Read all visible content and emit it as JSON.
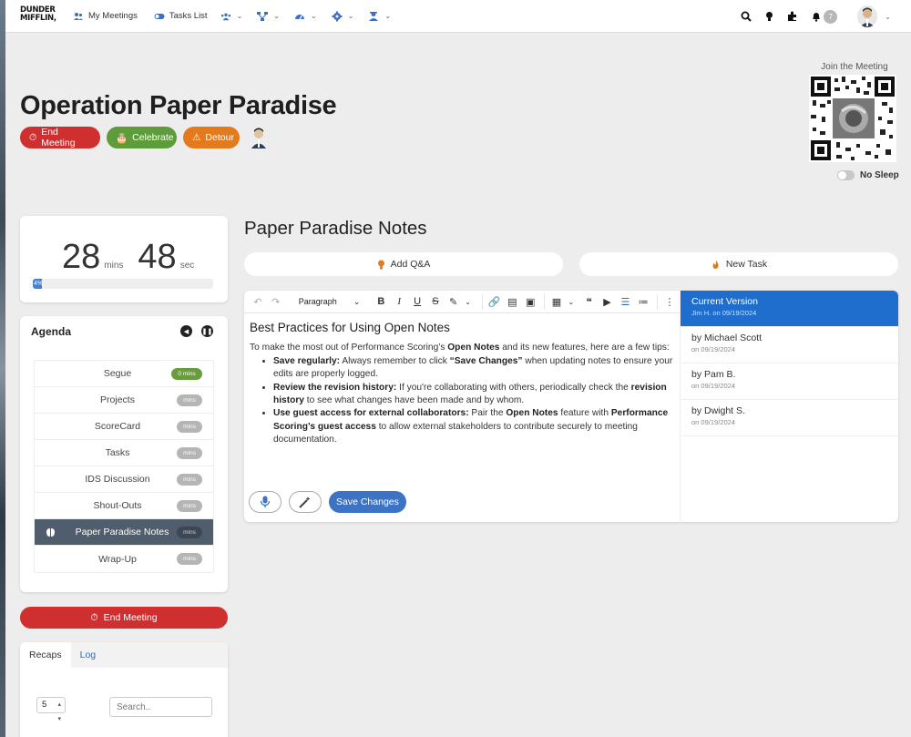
{
  "nav": {
    "logo_line1": "DUNDER",
    "logo_line2": "MIFFLIN,",
    "my_meetings": "My Meetings",
    "tasks_list": "Tasks List",
    "notification_count": "7",
    "icons": [
      "users-icon",
      "org-chart-icon",
      "dashboard-icon",
      "gear-icon",
      "admin-icon",
      "search-icon",
      "lightbulb-icon",
      "puzzle-icon",
      "bell-icon"
    ]
  },
  "header": {
    "title": "Operation Paper Paradise",
    "end_meeting": "End Meeting",
    "celebrate": "Celebrate",
    "detour": "Detour",
    "join_label": "Join the Meeting",
    "no_sleep": "No Sleep"
  },
  "timer": {
    "minutes": "28",
    "minutes_unit": "mins",
    "seconds": "48",
    "seconds_unit": "sec",
    "progress_label": "4%",
    "progress_value": 0.04
  },
  "agenda": {
    "title": "Agenda",
    "items": [
      {
        "label": "Segue",
        "mins": "0 mins"
      },
      {
        "label": "Projects",
        "mins": "mins"
      },
      {
        "label": "ScoreCard",
        "mins": "mins"
      },
      {
        "label": "Tasks",
        "mins": "mins"
      },
      {
        "label": "IDS Discussion",
        "mins": "mins"
      },
      {
        "label": "Shout-Outs",
        "mins": "mins"
      },
      {
        "label": "Paper Paradise Notes",
        "mins": "mins"
      },
      {
        "label": "Wrap-Up",
        "mins": "mins"
      }
    ],
    "end_meeting": "End Meeting"
  },
  "recaps": {
    "tab_recaps": "Recaps",
    "tab_log": "Log",
    "page_size": "5",
    "search_placeholder": "Search.."
  },
  "notes": {
    "title": "Paper Paradise Notes",
    "add_qa": "Add Q&A",
    "new_task": "New Task",
    "paragraph_style": "Paragraph",
    "doc_heading": "Best Practices for Using Open Notes",
    "intro_1": "To make the most out of Performance Scoring’s ",
    "intro_bold": "Open Notes",
    "intro_2": " and its new features, here are a few tips:",
    "tip1_bold": "Save regularly:",
    "tip1_a": " Always remember to click ",
    "tip1_quote": "“Save Changes”",
    "tip1_b": " when updating notes to ensure your edits are properly logged.",
    "tip2_bold": "Review the revision history:",
    "tip2_a": " If you're collaborating with others, periodically check the ",
    "tip2_bold2": "revision history",
    "tip2_b": " to see what changes have been made and by whom.",
    "tip3_bold": "Use guest access for external collaborators:",
    "tip3_a": " Pair the ",
    "tip3_bold2": "Open Notes",
    "tip3_b": " feature with ",
    "tip3_bold3": "Performance Scoring’s guest access",
    "tip3_c": " to allow external stakeholders to contribute securely to meeting documentation.",
    "save_changes": "Save Changes"
  },
  "versions": [
    {
      "name": "Current Version",
      "meta": "Jim H. on 09/19/2024"
    },
    {
      "name": "by Michael Scott",
      "meta": "on 09/19/2024"
    },
    {
      "name": "by Pam B.",
      "meta": "on 09/19/2024"
    },
    {
      "name": "by Dwight S.",
      "meta": "on 09/19/2024"
    }
  ],
  "colors": {
    "red": "#cf2f2f",
    "green": "#5e9b3b",
    "orange": "#e47a1b",
    "blue": "#1f6dcc"
  }
}
